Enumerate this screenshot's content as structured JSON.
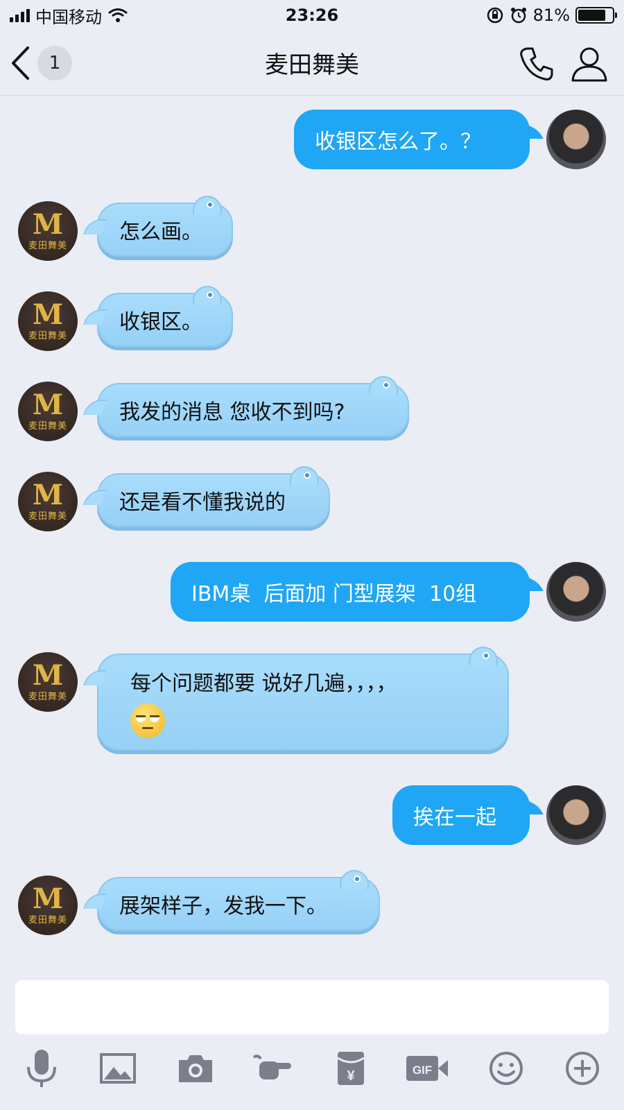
{
  "status_bar": {
    "carrier": "中国移动",
    "time": "23:26",
    "battery": "81%",
    "battery_level": 0.81
  },
  "nav": {
    "unread_count": "1",
    "title": "麦田舞美"
  },
  "avatar_logo": {
    "mark": "M",
    "sub": "麦田舞美"
  },
  "messages": [
    {
      "from": "me",
      "text": "收银区怎么了。？"
    },
    {
      "from": "them",
      "text": "怎么画。"
    },
    {
      "from": "them",
      "text": "收银区。"
    },
    {
      "from": "them",
      "text": "我发的消息 您收不到吗?"
    },
    {
      "from": "them",
      "text": "还是看不懂我说的"
    },
    {
      "from": "me",
      "text": "IBM桌  后面加 门型展架  10组"
    },
    {
      "from": "them",
      "text": "每个问题都要 说好几遍，，，，",
      "emoji": "eye-roll-emoji"
    },
    {
      "from": "me",
      "text": "挨在一起"
    },
    {
      "from": "them",
      "text": "展架样子，发我一下。"
    }
  ],
  "input": {
    "value": "",
    "placeholder": ""
  },
  "toolbar": {
    "gif_label": "GIF",
    "redpacket_label": "¥",
    "icons": [
      "microphone-icon",
      "image-icon",
      "camera-icon",
      "poke-hand-icon",
      "red-packet-icon",
      "gif-icon",
      "smiley-icon",
      "plus-icon"
    ]
  },
  "colors": {
    "background": "#ebedf5",
    "outgoing_bubble": "#1fa6f5",
    "incoming_bubble": "#a8dcfb"
  }
}
